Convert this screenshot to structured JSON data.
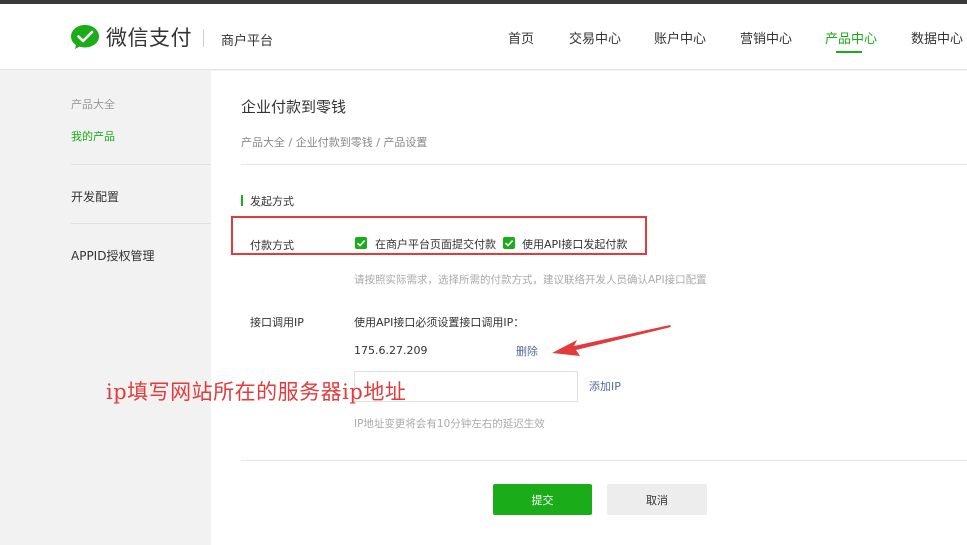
{
  "header": {
    "logo_text": "微信支付",
    "platform": "商户平台",
    "nav": [
      {
        "label": "首页",
        "active": false
      },
      {
        "label": "交易中心",
        "active": false
      },
      {
        "label": "账户中心",
        "active": false
      },
      {
        "label": "营销中心",
        "active": false
      },
      {
        "label": "产品中心",
        "active": true
      },
      {
        "label": "数据中心",
        "active": false
      }
    ]
  },
  "sidebar": {
    "group_label": "产品大全",
    "my_products": "我的产品",
    "dev_config": "开发配置",
    "appid_mgmt": "APPID授权管理"
  },
  "main": {
    "title": "企业付款到零钱",
    "breadcrumb": "产品大全 / 企业付款到零钱 / 产品设置",
    "section_title": "发起方式",
    "pay_method_label": "付款方式",
    "option_web": "在商户平台页面提交付款",
    "option_api": "使用API接口发起付款",
    "pay_method_hint": "请按照实际需求，选择所需的付款方式，建议联络开发人员确认API接口配置",
    "ip_label": "接口调用IP",
    "ip_desc": "使用API接口必须设置接口调用IP：",
    "ip_value": "175.6.27.209",
    "delete_link": "删除",
    "add_ip_link": "添加IP",
    "ip_input_value": "",
    "ip_hint": "IP地址变更将会有10分钟左右的延迟生效",
    "submit_label": "提交",
    "cancel_label": "取消"
  },
  "annotation": {
    "text": "ip填写网站所在的服务器ip地址",
    "color": "#e33b3b"
  },
  "colors": {
    "brand_green": "#1aad19",
    "link_blue": "#576b95",
    "highlight_red": "#e33b3b"
  },
  "icons": {
    "logo": "wechat-pay-logo-icon",
    "checkbox": "checkmark-icon",
    "arrow": "red-arrow-icon"
  }
}
